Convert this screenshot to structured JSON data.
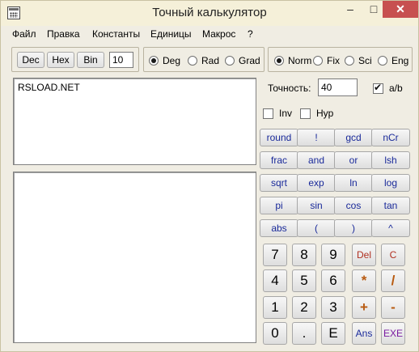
{
  "window": {
    "title": "Точный калькулятор"
  },
  "titlebar": {
    "minimize": "–",
    "maximize": "□",
    "close": "✕"
  },
  "menu": [
    "Файл",
    "Правка",
    "Константы",
    "Единицы",
    "Макрос",
    "?"
  ],
  "base": {
    "dec": "Dec",
    "hex": "Hex",
    "bin": "Bin",
    "value": "10"
  },
  "angle": {
    "options": [
      "Deg",
      "Rad",
      "Grad"
    ],
    "selected": "Deg"
  },
  "notation": {
    "options": [
      "Norm",
      "Fix",
      "Sci",
      "Eng"
    ],
    "selected": "Norm"
  },
  "precision": {
    "label": "Точность:",
    "value": "40"
  },
  "ab": {
    "label": "a/b",
    "checked": true
  },
  "inv": {
    "label": "Inv",
    "checked": false
  },
  "hyp": {
    "label": "Hyp",
    "checked": false
  },
  "expression_display": {
    "text": "RSLOAD.NET"
  },
  "result_display": {
    "text": ""
  },
  "function_buttons": [
    [
      "round",
      "!",
      "gcd",
      "nCr"
    ],
    [
      "frac",
      "and",
      "or",
      "lsh"
    ],
    [
      "sqrt",
      "exp",
      "ln",
      "log"
    ],
    [
      "pi",
      "sin",
      "cos",
      "tan"
    ],
    [
      "abs",
      "(",
      ")",
      "^"
    ]
  ],
  "keypad": [
    [
      "7",
      "8",
      "9",
      "Del",
      "C"
    ],
    [
      "4",
      "5",
      "6",
      "*",
      "/"
    ],
    [
      "1",
      "2",
      "3",
      "+",
      "-"
    ],
    [
      "0",
      ".",
      "E",
      "Ans",
      "EXE"
    ]
  ],
  "colors": {
    "function_text": "#1a2a9a",
    "del_c": "#b03020",
    "operator": "#b85a10",
    "exe": "#7a1aa0"
  },
  "icons": {
    "app": "calculator-icon"
  }
}
